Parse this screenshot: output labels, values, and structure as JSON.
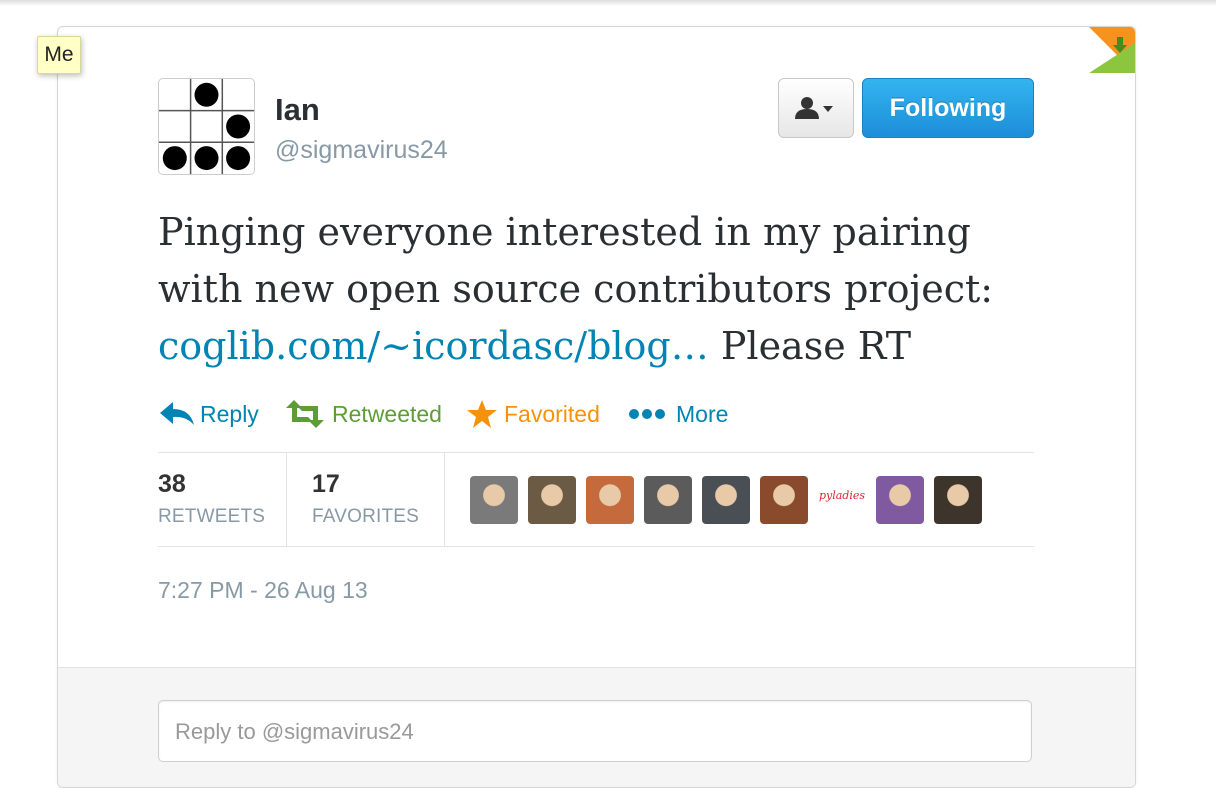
{
  "tooltip": {
    "label": "Me"
  },
  "user": {
    "name": "Ian",
    "handle": "@sigmavirus24"
  },
  "buttons": {
    "user_dropdown_icon": "person-icon",
    "follow_label": "Following"
  },
  "tweet": {
    "text_before": "Pinging everyone interested in my pairing with new open source contributors project: ",
    "link_text": "coglib.com/~icordasc/blog…",
    "text_after": " Please RT"
  },
  "actions": {
    "reply": "Reply",
    "retweet": "Retweeted",
    "favorite": "Favorited",
    "more": "More"
  },
  "stats": {
    "retweets_count": "38",
    "retweets_label": "RETWEETS",
    "favorites_count": "17",
    "favorites_label": "FAVORITES"
  },
  "favoriters": [
    {
      "name": "favoriter-1",
      "color": "#7a7a7a"
    },
    {
      "name": "favoriter-2",
      "color": "#6b5a44"
    },
    {
      "name": "favoriter-3",
      "color": "#c56a3c"
    },
    {
      "name": "favoriter-4",
      "color": "#5b5b5b"
    },
    {
      "name": "favoriter-5",
      "color": "#4a4f55"
    },
    {
      "name": "favoriter-6",
      "color": "#8a4b2c"
    },
    {
      "name": "favoriter-7",
      "text": "pyladies",
      "color": "#d7262f"
    },
    {
      "name": "favoriter-8",
      "color": "#7f5aa0"
    },
    {
      "name": "favoriter-9",
      "color": "#3d342c"
    }
  ],
  "timestamp": "7:27 PM - 26 Aug 13",
  "reply_box": {
    "placeholder": "Reply to @sigmavirus24"
  },
  "colors": {
    "link": "#0084b4",
    "retweeted": "#5c9e35",
    "favorited": "#f5920b",
    "follow_button": "#2aa3e6"
  }
}
